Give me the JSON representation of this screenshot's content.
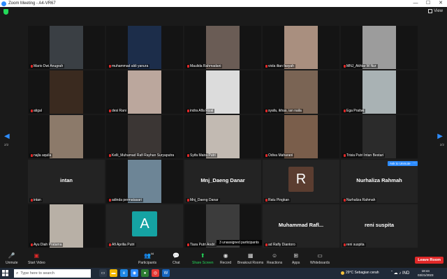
{
  "window": {
    "title": "Zoom Meeting - A4-VR67",
    "controls": [
      "—",
      "☐",
      "✕"
    ]
  },
  "topbar": {
    "view_label": "View"
  },
  "gallery": {
    "page_left": "2/2",
    "page_right": "2/2",
    "tiles": [
      {
        "name": "Mario Dwi Anugrah",
        "kind": "video",
        "bg": "#3a3f44"
      },
      {
        "name": "muhammad aldi yanura",
        "kind": "video",
        "bg": "#1c2d4a"
      },
      {
        "name": "Maulida Rahmadani",
        "kind": "video",
        "bg": "#6a5c55"
      },
      {
        "name": "viola iltan fasyah",
        "kind": "video",
        "bg": "#a98f7f"
      },
      {
        "name": "MNJ_Akhtar M Nur",
        "kind": "video",
        "bg": "#9c9c9c"
      },
      {
        "name": "atigal",
        "kind": "video",
        "bg": "#3a2a1f"
      },
      {
        "name": "desi Rani",
        "kind": "video",
        "bg": "#bba79d"
      },
      {
        "name": "indra Alfa Rizal",
        "kind": "video",
        "bg": "#dcdcdc"
      },
      {
        "name": "syafa, ikhas, ian naila",
        "kind": "video",
        "bg": "#7a6454"
      },
      {
        "name": "Ega Pratiwi",
        "kind": "video",
        "bg": "#a9b2b4"
      },
      {
        "name": "najla aquila",
        "kind": "video",
        "bg": "#8c7a6a"
      },
      {
        "name": "Kelli_Muhamad Rafi Rayhan Suryaputra",
        "kind": "video",
        "bg": "#3b3634"
      },
      {
        "name": "Syifa Maira Putri",
        "kind": "video",
        "bg": "#c2bab2"
      },
      {
        "name": "Odiva Maharani",
        "kind": "video",
        "bg": "#7a5e4b"
      },
      {
        "name": "Trisia Putri Intan Bestari",
        "kind": "video",
        "bg": "#2b2b2b"
      },
      {
        "name": "intan",
        "kind": "text",
        "big": "intan"
      },
      {
        "name": "adinda permatasari",
        "kind": "video",
        "bg": "#6d8596"
      },
      {
        "name": "Mnj_Daeng Danar",
        "kind": "text",
        "big": "Mnj_Daeng Danar"
      },
      {
        "name": "Ratu Pingkan",
        "kind": "avatar",
        "letter": "R",
        "bg": "#5b3d30"
      },
      {
        "name": "Nurhaliza Rahmah",
        "kind": "text",
        "big": "Nurhaliza Rahmah"
      },
      {
        "name": "Ayu Diah Pratama",
        "kind": "video",
        "bg": "#b8b0a6"
      },
      {
        "name": "Afi Aprilia Putri",
        "kind": "avatar",
        "letter": "A",
        "bg": "#15a3a3"
      },
      {
        "name": "Tiara Putri Andri",
        "kind": "video",
        "bg": "#3c3c3c"
      },
      {
        "name": "ad Rafly Diantoro",
        "kind": "text",
        "big": "Muhammad  Rafl..."
      },
      {
        "name": "reni suspita",
        "kind": "text",
        "big": "reni suspita"
      }
    ],
    "ask_unmute": "Ask to Unmute",
    "ask_more": "···",
    "unassigned": "3 unassigned participants"
  },
  "toolbar": {
    "unmute": "Unmute",
    "start_video": "Start Video",
    "participants": "Participants",
    "participants_count": "44",
    "chat": "Chat",
    "share_screen": "Share Screen",
    "record": "Record",
    "breakout": "Breakout Rooms",
    "reactions": "Reactions",
    "apps": "Apps",
    "whiteboards": "Whiteboards",
    "leave": "Leave Room"
  },
  "taskbar": {
    "search_placeholder": "Type here to search",
    "weather": "29°C  Sebagian cerah",
    "time": "18:44",
    "date": "03/21/2023",
    "tray": "ˆ ☁ ♪ IND"
  },
  "colors": {
    "accent": "#2d8cff",
    "danger": "#e02828",
    "green": "#23d959"
  }
}
